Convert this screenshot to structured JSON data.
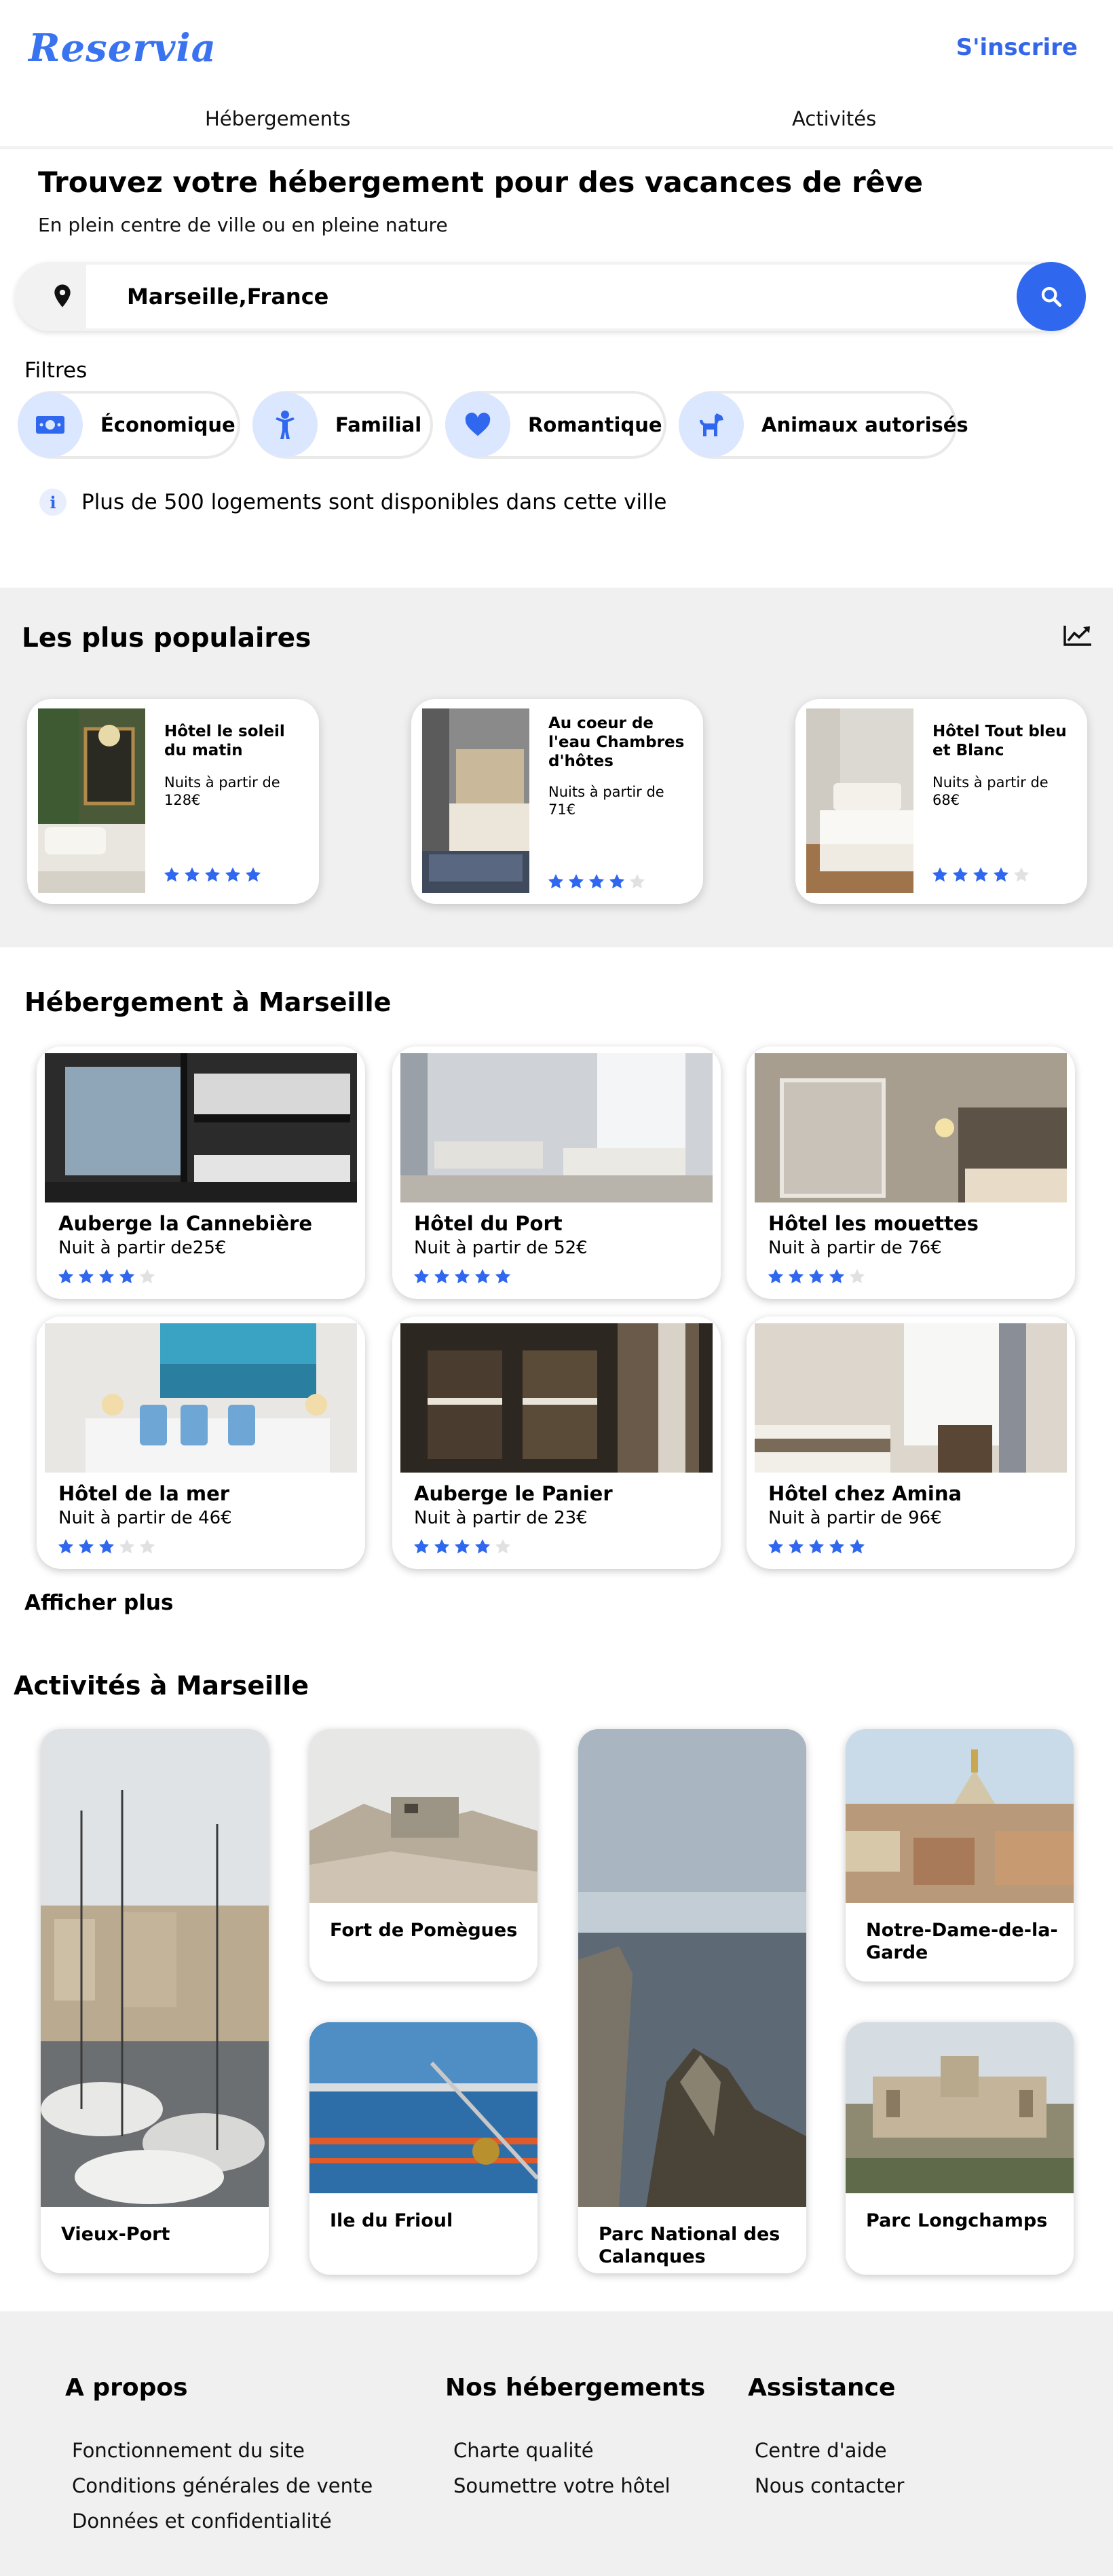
{
  "header": {
    "logo": "Reservia",
    "signup": "S'inscrire",
    "tabs": [
      "Hébergements",
      "Activités"
    ]
  },
  "hero": {
    "title": "Trouvez votre hébergement pour des vacances de rêve",
    "subtitle": "En plein centre de ville ou en pleine nature",
    "search_value": "Marseille,France"
  },
  "filters": {
    "label": "Filtres",
    "items": [
      {
        "label": "Économique",
        "icon": "money-icon"
      },
      {
        "label": "Familial",
        "icon": "child-icon"
      },
      {
        "label": "Romantique",
        "icon": "heart-icon"
      },
      {
        "label": "Animaux autorisés",
        "icon": "dog-icon"
      }
    ]
  },
  "info": {
    "text": "Plus de 500 logements sont disponibles dans cette ville"
  },
  "popular": {
    "title": "Les plus populaires",
    "items": [
      {
        "name": "Hôtel le soleil du matin",
        "price": "Nuits à partir de 128€",
        "rating": 5
      },
      {
        "name": "Au coeur de l'eau Chambres d'hôtes",
        "price": "Nuits à partir de 71€",
        "rating": 4
      },
      {
        "name": "Hôtel Tout bleu et Blanc",
        "price": "Nuits à partir de 68€",
        "rating": 4
      }
    ]
  },
  "accommodation": {
    "title": "Hébergement à Marseille",
    "items": [
      {
        "name": "Auberge la Cannebière",
        "price": "Nuit à partir de25€",
        "rating": 4
      },
      {
        "name": "Hôtel du Port",
        "price": "Nuit à partir de 52€",
        "rating": 5
      },
      {
        "name": "Hôtel les mouettes",
        "price": "Nuit à partir de 76€",
        "rating": 4
      },
      {
        "name": "Hôtel de la mer",
        "price": "Nuit à partir de 46€",
        "rating": 3
      },
      {
        "name": "Auberge le Panier",
        "price": "Nuit à partir de 23€",
        "rating": 4
      },
      {
        "name": "Hôtel chez Amina",
        "price": "Nuit à partir de 96€",
        "rating": 5
      }
    ],
    "show_more": "Afficher plus"
  },
  "activities": {
    "title": "Activités à Marseille",
    "items": [
      {
        "name": "Vieux-Port"
      },
      {
        "name": "Fort de Pomègues"
      },
      {
        "name": "Ile du Frioul"
      },
      {
        "name": "Parc National des Calanques"
      },
      {
        "name": "Notre-Dame-de-la-Garde"
      },
      {
        "name": "Parc Longchamps"
      }
    ]
  },
  "footer": {
    "columns": [
      {
        "title": "A propos",
        "links": [
          "Fonctionnement du site",
          "Conditions générales de vente",
          "Données et confidentialité"
        ]
      },
      {
        "title": "Nos hébergements",
        "links": [
          "Charte qualité",
          "Soumettre votre hôtel"
        ]
      },
      {
        "title": "Assistance",
        "links": [
          "Centre d'aide",
          "Nous contacter"
        ]
      }
    ]
  },
  "colors": {
    "accent": "#2f67ee",
    "star_on": "#2f67ee",
    "star_off": "#e1e1e1",
    "section_bg": "#f0f0f0"
  }
}
